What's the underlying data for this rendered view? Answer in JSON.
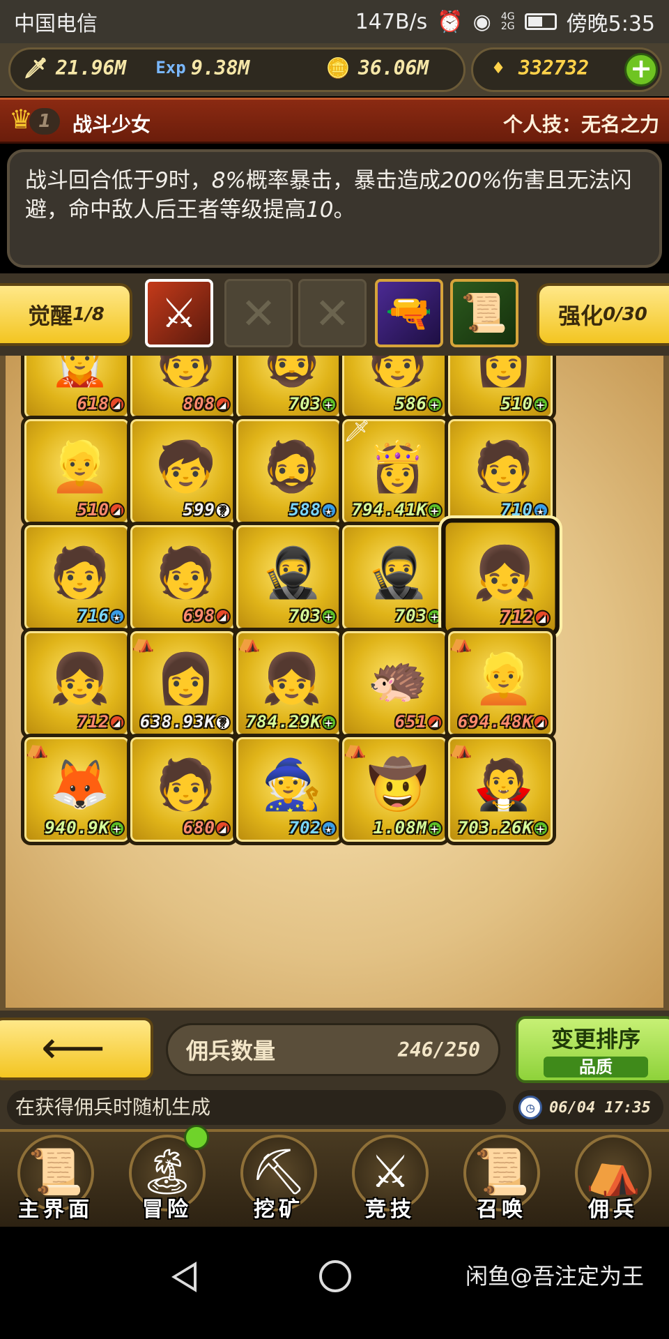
{
  "status": {
    "carrier": "中国电信",
    "speed": "147B/s",
    "network": [
      "4G",
      "2G"
    ],
    "time": "傍晚5:35"
  },
  "resources": {
    "attack": "21.96M",
    "exp_label": "Exp",
    "exp": "9.38M",
    "gold": "36.06M",
    "gems": "332732"
  },
  "hero": {
    "rank": "1",
    "name": "战斗少女",
    "skill": "个人技：无名之力",
    "desc_prefix": "战斗回合低于",
    "desc_n1": "9",
    "desc_mid1": "时，",
    "desc_n2": "8%",
    "desc_mid2": "概率暴击，暴击造成",
    "desc_n3": "200%",
    "desc_mid3": "伤害且无法闪避，命中敌人后王者等级提高",
    "desc_n4": "10",
    "desc_suffix": "。"
  },
  "skills": {
    "awaken_label": "觉醒",
    "awaken_value": "1/8",
    "upgrade_label": "强化",
    "upgrade_value": "0/30"
  },
  "mercs": [
    {
      "lvl": "618",
      "badge": "red",
      "icon": "🧝"
    },
    {
      "lvl": "808",
      "badge": "red",
      "icon": "🧑"
    },
    {
      "lvl": "703",
      "badge": "green",
      "icon": "🧔"
    },
    {
      "lvl": "586",
      "badge": "green",
      "icon": "🧑"
    },
    {
      "lvl": "510",
      "badge": "green",
      "icon": "👩"
    },
    {
      "lvl": "510",
      "badge": "red",
      "icon": "👱"
    },
    {
      "lvl": "599",
      "badge": "white",
      "icon": "🧒"
    },
    {
      "lvl": "588",
      "badge": "blue",
      "icon": "🧔"
    },
    {
      "lvl": "794.41K",
      "badge": "green",
      "icon": "👸",
      "sword": true
    },
    {
      "lvl": "710",
      "badge": "blue",
      "icon": "🧑"
    },
    {
      "lvl": "716",
      "badge": "blue",
      "icon": "🧑"
    },
    {
      "lvl": "698",
      "badge": "red",
      "icon": "🧑"
    },
    {
      "lvl": "703",
      "badge": "green",
      "icon": "🥷"
    },
    {
      "lvl": "703",
      "badge": "green",
      "icon": "🥷"
    },
    {
      "lvl": "712",
      "badge": "red",
      "icon": "👧",
      "selected": true
    },
    {
      "lvl": "712",
      "badge": "red",
      "icon": "👧"
    },
    {
      "lvl": "638.93K",
      "badge": "white",
      "icon": "👩",
      "tent": true
    },
    {
      "lvl": "784.29K",
      "badge": "green",
      "icon": "👧",
      "tent": true
    },
    {
      "lvl": "651",
      "badge": "red",
      "icon": "🦔"
    },
    {
      "lvl": "694.48K",
      "badge": "red",
      "icon": "👱",
      "tent": true
    },
    {
      "lvl": "940.9K",
      "badge": "green",
      "icon": "🦊",
      "tent": true
    },
    {
      "lvl": "680",
      "badge": "red",
      "icon": "🧑"
    },
    {
      "lvl": "702",
      "badge": "blue",
      "icon": "🧙"
    },
    {
      "lvl": "1.08M",
      "badge": "green",
      "icon": "🤠",
      "tent": true
    },
    {
      "lvl": "703.26K",
      "badge": "green",
      "icon": "🧛",
      "tent": true
    }
  ],
  "footer": {
    "count_label": "佣兵数量",
    "count_value": "246/250",
    "sort_label": "变更排序",
    "sort_mode": "品质",
    "tip": "在获得佣兵时随机生成",
    "timestamp": "06/04 17:35"
  },
  "nav": [
    {
      "label": "主界面",
      "icon": "📜"
    },
    {
      "label": "冒险",
      "icon": "🏝"
    },
    {
      "label": "挖矿",
      "icon": "⛏"
    },
    {
      "label": "竞技",
      "icon": "⚔"
    },
    {
      "label": "召唤",
      "icon": "📜"
    },
    {
      "label": "佣兵",
      "icon": "⛺"
    }
  ],
  "watermark": "闲鱼@吾注定为王"
}
